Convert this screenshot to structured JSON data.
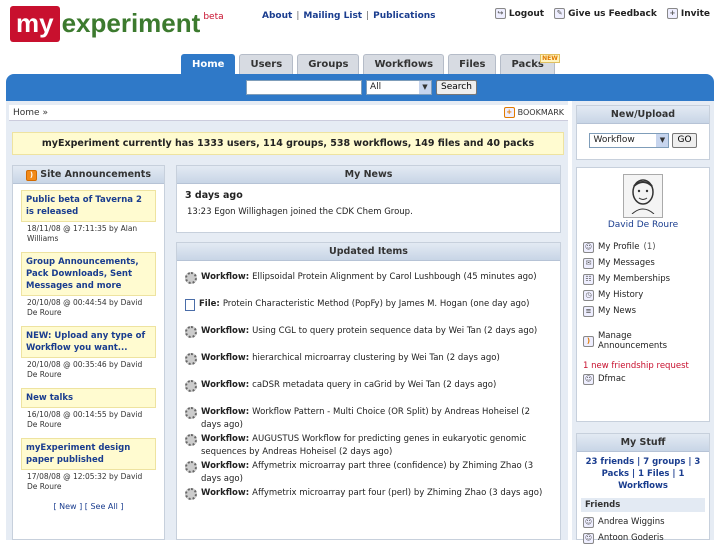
{
  "logo": {
    "my": "my",
    "experiment": "experiment",
    "beta": "beta"
  },
  "toplinks": [
    "About",
    "Mailing List",
    "Publications"
  ],
  "rightlinks": [
    "Logout",
    "Give us Feedback",
    "Invite"
  ],
  "tabs": [
    "Home",
    "Users",
    "Groups",
    "Workflows",
    "Files",
    "Packs"
  ],
  "new_badge": "NEW",
  "search": {
    "value": "",
    "select": "All",
    "button": "Search"
  },
  "breadcrumb": "Home »",
  "bookmark": "BOOKMARK",
  "announcement": "myExperiment currently has 1333 users, 114 groups, 538 workflows, 149 files and 40 packs",
  "site_announcements": {
    "title": "Site Announcements",
    "items": [
      {
        "title": "Public beta of Taverna 2 is released",
        "meta": "18/11/08 @ 17:11:35 by Alan Williams"
      },
      {
        "title": "Group Announcements, Pack Downloads, Sent Messages and more",
        "meta": "20/10/08 @ 00:44:54 by David De Roure"
      },
      {
        "title": "NEW: Upload any type of Workflow you want...",
        "meta": "20/10/08 @ 00:35:46 by David De Roure"
      },
      {
        "title": "New talks",
        "meta": "16/10/08 @ 00:14:55 by David De Roure"
      },
      {
        "title": "myExperiment design paper published",
        "meta": "17/08/08 @ 12:05:32 by David De Roure"
      }
    ],
    "footer": "[ New ] [ See All ]"
  },
  "my_news": {
    "title": "My News",
    "subtitle": "3 days ago",
    "line": "13:23 Egon Willighagen joined the CDK Chem Group."
  },
  "updated": {
    "title": "Updated Items",
    "items": [
      {
        "icon": "workflow",
        "kind": "Workflow:",
        "text": "Ellipsoidal Protein Alignment by Carol Lushbough (45 minutes ago)"
      },
      {
        "icon": "file",
        "kind": "File:",
        "text": "Protein Characteristic Method (PopFy) by James M. Hogan (one day ago)"
      },
      {
        "icon": "workflow",
        "kind": "Workflow:",
        "text": "Using CGL to query protein sequence data by Wei Tan (2 days ago)"
      },
      {
        "icon": "workflow",
        "kind": "Workflow:",
        "text": "hierarchical microarray clustering by Wei Tan (2 days ago)"
      },
      {
        "icon": "workflow",
        "kind": "Workflow:",
        "text": "caDSR metadata query in caGrid by Wei Tan (2 days ago)"
      },
      {
        "icon": "workflow",
        "kind": "Workflow:",
        "text": "Workflow Pattern - Multi Choice (OR Split) by Andreas Hoheisel (2 days ago)"
      },
      {
        "icon": "workflow",
        "kind": "Workflow:",
        "text": "AUGUSTUS Workflow for predicting genes in eukaryotic genomic sequences by Andreas Hoheisel (2 days ago)"
      },
      {
        "icon": "workflow",
        "kind": "Workflow:",
        "text": "Affymetrix microarray part three (confidence) by Zhiming Zhao (3 days ago)"
      },
      {
        "icon": "workflow",
        "kind": "Workflow:",
        "text": "Affymetrix microarray part four (perl) by Zhiming Zhao (3 days ago)"
      }
    ]
  },
  "new_upload": {
    "title": "New/Upload",
    "select": "Workflow",
    "button": "GO"
  },
  "profile": {
    "name": "David De Roure",
    "links": [
      "My Profile",
      "My Messages",
      "My Memberships",
      "My History",
      "My News",
      "Manage Announcements"
    ],
    "profile_badge": "1",
    "friend_request": "1 new friendship request",
    "friend_name": "Dfmac"
  },
  "my_stuff": {
    "title": "My Stuff",
    "summary": "23 friends | 7 groups | 3 Packs | 1 Files | 1 Workflows",
    "friends_header": "Friends",
    "friends": [
      "Andrea Wiggins",
      "Antoon Goderis"
    ]
  }
}
